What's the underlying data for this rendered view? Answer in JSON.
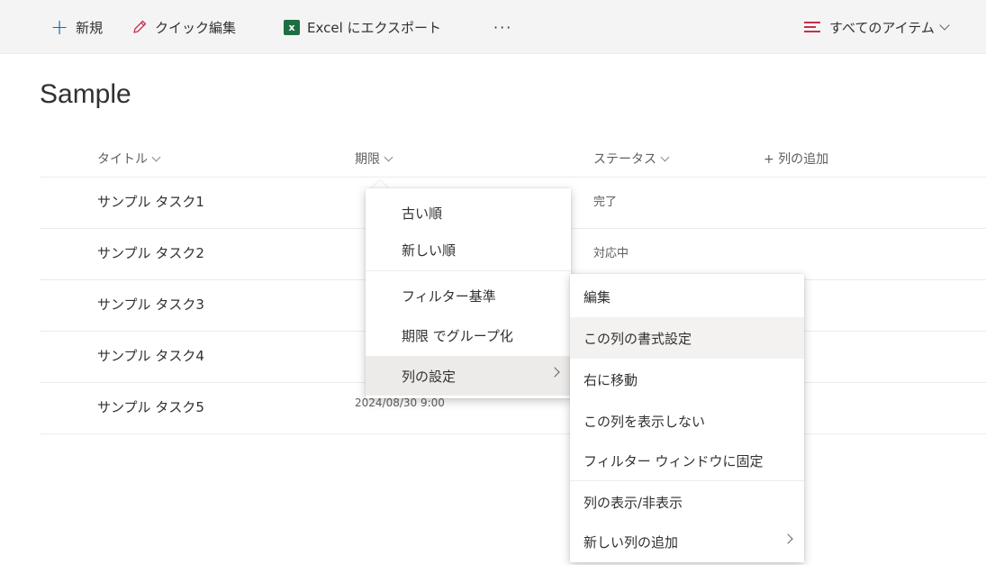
{
  "command_bar": {
    "new_label": "新規",
    "quick_edit_label": "クイック編集",
    "excel_label": "Excel にエクスポート",
    "excel_icon_letter": "x",
    "more_label": "···",
    "view_label": "すべてのアイテム"
  },
  "page": {
    "title": "Sample"
  },
  "columns": {
    "title": "タイトル",
    "due": "期限",
    "status": "ステータス",
    "add": "+ 列の追加"
  },
  "rows": [
    {
      "title": "サンプル タスク1",
      "due": "",
      "status": "完了"
    },
    {
      "title": "サンプル タスク2",
      "due": "",
      "status": "対応中"
    },
    {
      "title": "サンプル タスク3",
      "due": "",
      "status": ""
    },
    {
      "title": "サンプル タスク4",
      "due": "",
      "status": ""
    },
    {
      "title": "サンプル タスク5",
      "due": "2024/08/30 9:00",
      "status": ""
    }
  ],
  "column_menu": {
    "items": [
      "古い順",
      "新しい順",
      "フィルター基準",
      "期限 でグループ化",
      "列の設定"
    ],
    "selected": "列の設定"
  },
  "submenu": {
    "items": [
      "編集",
      "この列の書式設定",
      "右に移動",
      "この列を表示しない",
      "フィルター ウィンドウに固定",
      "列の表示/非表示",
      "新しい列の追加"
    ],
    "highlighted": "この列の書式設定"
  },
  "colors": {
    "accent": "#0f6cbd",
    "excel": "#1d6f42",
    "view_icon": "#c4314b"
  }
}
